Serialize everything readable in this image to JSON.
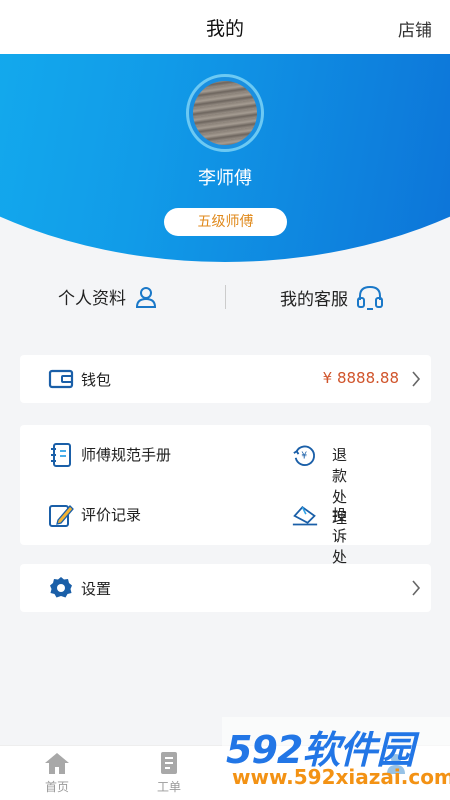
{
  "header": {
    "title": "我的",
    "shop_link": "店铺"
  },
  "profile": {
    "name": "李师傅",
    "level": "五级师傅"
  },
  "quick_actions": {
    "profile_label": "个人资料",
    "service_label": "我的客服"
  },
  "wallet": {
    "label": "钱包",
    "amount": "¥ 8888.88"
  },
  "grid_items": {
    "handbook": "师傅规范手册",
    "refund": "退款处理",
    "reviews": "评价记录",
    "complaints": "投诉处理"
  },
  "settings": {
    "label": "设置"
  },
  "tabbar": {
    "home": "首页",
    "orders": "工单"
  },
  "watermark": {
    "brand": "592软件园",
    "url": "www.592xiazai.com"
  },
  "colors": {
    "accent": "#1a78c8",
    "hero_start": "#16bdf4",
    "hero_end": "#0a5ecf",
    "level_text": "#e08a1c",
    "amount": "#d0542b"
  }
}
